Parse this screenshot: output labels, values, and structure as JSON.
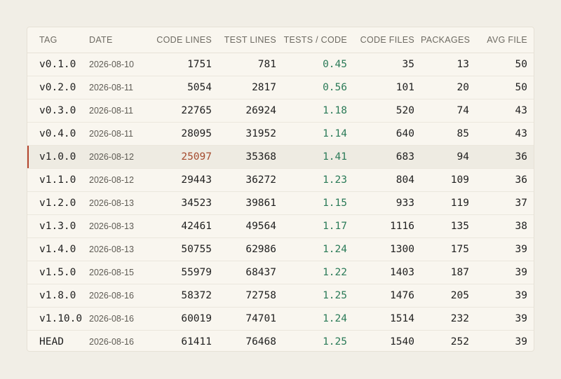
{
  "table": {
    "headers": {
      "tag": "TAG",
      "date": "DATE",
      "code_lines": "CODE LINES",
      "test_lines": "TEST LINES",
      "ratio": "TESTS / CODE",
      "code_files": "CODE FILES",
      "packages": "PACKAGES",
      "avg_file": "AVG FILE"
    },
    "highlighted_row": "v1.0.0",
    "colors": {
      "ratio": "#2a7a57",
      "highlight_accent": "#b5452f",
      "highlight_value": "#a54b2f"
    },
    "rows": [
      {
        "tag": "v0.1.0",
        "date": "2026-08-10",
        "code_lines": "1751",
        "test_lines": "781",
        "ratio": "0.45",
        "code_files": "35",
        "packages": "13",
        "avg_file": "50"
      },
      {
        "tag": "v0.2.0",
        "date": "2026-08-11",
        "code_lines": "5054",
        "test_lines": "2817",
        "ratio": "0.56",
        "code_files": "101",
        "packages": "20",
        "avg_file": "50"
      },
      {
        "tag": "v0.3.0",
        "date": "2026-08-11",
        "code_lines": "22765",
        "test_lines": "26924",
        "ratio": "1.18",
        "code_files": "520",
        "packages": "74",
        "avg_file": "43"
      },
      {
        "tag": "v0.4.0",
        "date": "2026-08-11",
        "code_lines": "28095",
        "test_lines": "31952",
        "ratio": "1.14",
        "code_files": "640",
        "packages": "85",
        "avg_file": "43"
      },
      {
        "tag": "v1.0.0",
        "date": "2026-08-12",
        "code_lines": "25097",
        "test_lines": "35368",
        "ratio": "1.41",
        "code_files": "683",
        "packages": "94",
        "avg_file": "36"
      },
      {
        "tag": "v1.1.0",
        "date": "2026-08-12",
        "code_lines": "29443",
        "test_lines": "36272",
        "ratio": "1.23",
        "code_files": "804",
        "packages": "109",
        "avg_file": "36"
      },
      {
        "tag": "v1.2.0",
        "date": "2026-08-13",
        "code_lines": "34523",
        "test_lines": "39861",
        "ratio": "1.15",
        "code_files": "933",
        "packages": "119",
        "avg_file": "37"
      },
      {
        "tag": "v1.3.0",
        "date": "2026-08-13",
        "code_lines": "42461",
        "test_lines": "49564",
        "ratio": "1.17",
        "code_files": "1116",
        "packages": "135",
        "avg_file": "38"
      },
      {
        "tag": "v1.4.0",
        "date": "2026-08-13",
        "code_lines": "50755",
        "test_lines": "62986",
        "ratio": "1.24",
        "code_files": "1300",
        "packages": "175",
        "avg_file": "39"
      },
      {
        "tag": "v1.5.0",
        "date": "2026-08-15",
        "code_lines": "55979",
        "test_lines": "68437",
        "ratio": "1.22",
        "code_files": "1403",
        "packages": "187",
        "avg_file": "39"
      },
      {
        "tag": "v1.8.0",
        "date": "2026-08-16",
        "code_lines": "58372",
        "test_lines": "72758",
        "ratio": "1.25",
        "code_files": "1476",
        "packages": "205",
        "avg_file": "39"
      },
      {
        "tag": "v1.10.0",
        "date": "2026-08-16",
        "code_lines": "60019",
        "test_lines": "74701",
        "ratio": "1.24",
        "code_files": "1514",
        "packages": "232",
        "avg_file": "39"
      },
      {
        "tag": "HEAD",
        "date": "2026-08-16",
        "code_lines": "61411",
        "test_lines": "76468",
        "ratio": "1.25",
        "code_files": "1540",
        "packages": "252",
        "avg_file": "39"
      }
    ]
  }
}
